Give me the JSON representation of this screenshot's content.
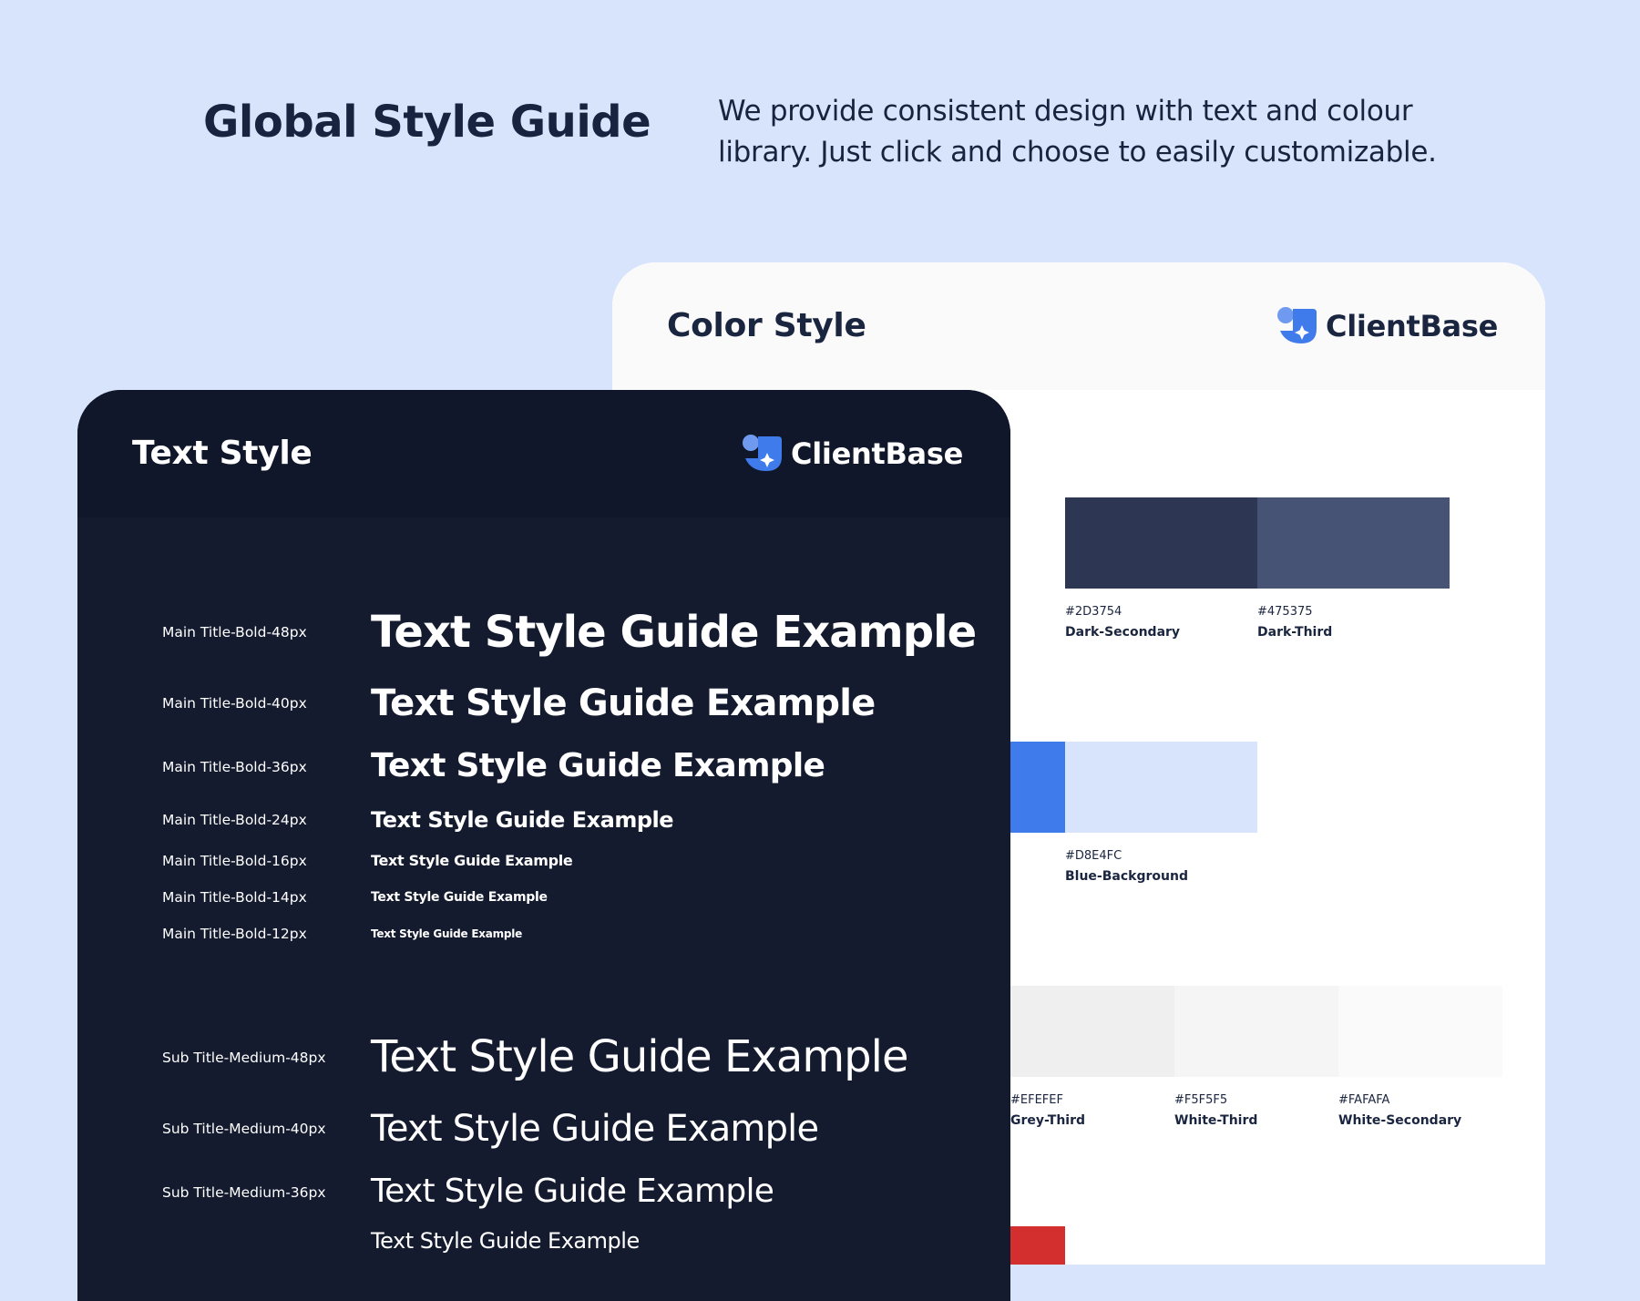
{
  "hero": {
    "title": "Global Style Guide",
    "description": "We provide consistent design with text and colour library. Just click and choose to easily customizable."
  },
  "color_card": {
    "title": "Color Style",
    "logo_text": "ClientBase",
    "swatches": [
      {
        "hex": "#2D3754",
        "name": "Dark-Secondary",
        "color": "#2D3754"
      },
      {
        "hex": "#475375",
        "name": "Dark-Third",
        "color": "#475375"
      },
      {
        "hex": "#D8E4FC",
        "name": "Blue-Background",
        "color": "#D8E4FC"
      },
      {
        "hex": "#EFEFEF",
        "name": "Grey-Third",
        "color": "#EFEFEF"
      },
      {
        "hex": "#F5F5F5",
        "name": "White-Third",
        "color": "#F5F5F5"
      },
      {
        "hex": "#FAFAFA",
        "name": "White-Secondary",
        "color": "#FAFAFA"
      }
    ],
    "partial_swatch_colors": {
      "dark": "#141B2F",
      "blue": "#3F7BEB",
      "red": "#D32F2F"
    }
  },
  "text_card": {
    "title": "Text Style",
    "logo_text": "ClientBase",
    "rows": [
      {
        "label": "Main Title-Bold-48px",
        "sample": "Text Style Guide Example"
      },
      {
        "label": "Main Title-Bold-40px",
        "sample": "Text Style Guide Example"
      },
      {
        "label": "Main Title-Bold-36px",
        "sample": "Text Style Guide Example"
      },
      {
        "label": "Main Title-Bold-24px",
        "sample": "Text Style Guide Example"
      },
      {
        "label": "Main Title-Bold-16px",
        "sample": "Text Style Guide Example"
      },
      {
        "label": "Main Title-Bold-14px",
        "sample": "Text Style Guide Example"
      },
      {
        "label": "Main Title-Bold-12px",
        "sample": "Text Style Guide Example"
      },
      {
        "label": "Sub Title-Medium-48px",
        "sample": "Text Style Guide Example"
      },
      {
        "label": "Sub Title-Medium-40px",
        "sample": "Text Style Guide Example"
      },
      {
        "label": "Sub Title-Medium-36px",
        "sample": "Text Style Guide Example"
      },
      {
        "label": "",
        "sample": "Text Style Guide Example"
      }
    ]
  },
  "colors": {
    "page_background": "#D8E4FC",
    "brand_blue": "#3F7BEB",
    "navy": "#1A2540"
  },
  "icons": {
    "logo": "clientbase-logo-icon"
  }
}
